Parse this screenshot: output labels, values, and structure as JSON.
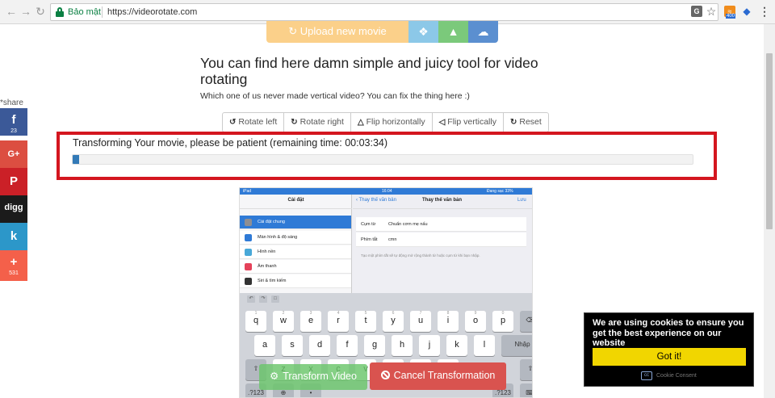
{
  "browser": {
    "secure_label": "Bảo mật",
    "url": "https://videorotate.com",
    "rss_badge": "400"
  },
  "upload": {
    "label": "Upload new movie"
  },
  "page": {
    "headline": "You can find here damn simple and juicy tool for video rotating",
    "subline": "Which one of us never made vertical video? You can fix the thing here :)"
  },
  "toolbar": {
    "items": [
      {
        "label": "Rotate left",
        "icon": "rotate-left-icon"
      },
      {
        "label": "Rotate right",
        "icon": "rotate-right-icon"
      },
      {
        "label": "Flip horizontally",
        "icon": "flip-horizontal-icon"
      },
      {
        "label": "Flip vertically",
        "icon": "flip-vertical-icon"
      },
      {
        "label": "Reset",
        "icon": "reset-icon"
      }
    ]
  },
  "progress": {
    "label": "Transforming Your movie, please be patient (remaining time: 00:03:34)",
    "percent": 1
  },
  "share": {
    "label": "*share",
    "facebook_count": "23",
    "plus_count": "531",
    "digg_label": "digg"
  },
  "video": {
    "left_title": "Cài đặt",
    "settings": [
      "Cài đặt chung",
      "Màn hình & độ sáng",
      "Hình nền",
      "Âm thanh",
      "Siri & tìm kiếm"
    ],
    "back_label": "Thay thế văn bản",
    "right_title": "Thay thế văn bản",
    "save_label": "Lưu",
    "field1_label": "Cụm từ",
    "field1_value": "Chuẩn cơm mẹ nấu",
    "field2_label": "Phím tắt",
    "field2_value": "cmn",
    "note": "Tạo một phím tắt sẽ tự động mở rộng thành từ hoặc cụm từ khi bạn nhập."
  },
  "keyboard": {
    "row1": [
      "q",
      "w",
      "e",
      "r",
      "t",
      "y",
      "u",
      "i",
      "o",
      "p"
    ],
    "row1_alt": [
      "1",
      "2",
      "3",
      "4",
      "5",
      "6",
      "7",
      "8",
      "9",
      "0"
    ],
    "row2": [
      "a",
      "s",
      "d",
      "f",
      "g",
      "h",
      "j",
      "k",
      "l"
    ],
    "row3": [
      "z",
      "x",
      "c",
      "v",
      "b",
      "n",
      "m"
    ],
    "return_label": "Nhập",
    "num_label": ".?123"
  },
  "actions": {
    "transform_label": "Transform Video",
    "cancel_label": "Cancel Transformation"
  },
  "cookie": {
    "message": "We are using cookies to ensure you get the best experience on our website",
    "ok_label": "Got it!",
    "brand": "Cookie Consent"
  },
  "colors": {
    "highlight_border": "#d4161f",
    "progress_fill": "#337ab7",
    "cancel": "#d9534f",
    "transform": "#6ac66a",
    "cookie_button": "#f1d600"
  }
}
